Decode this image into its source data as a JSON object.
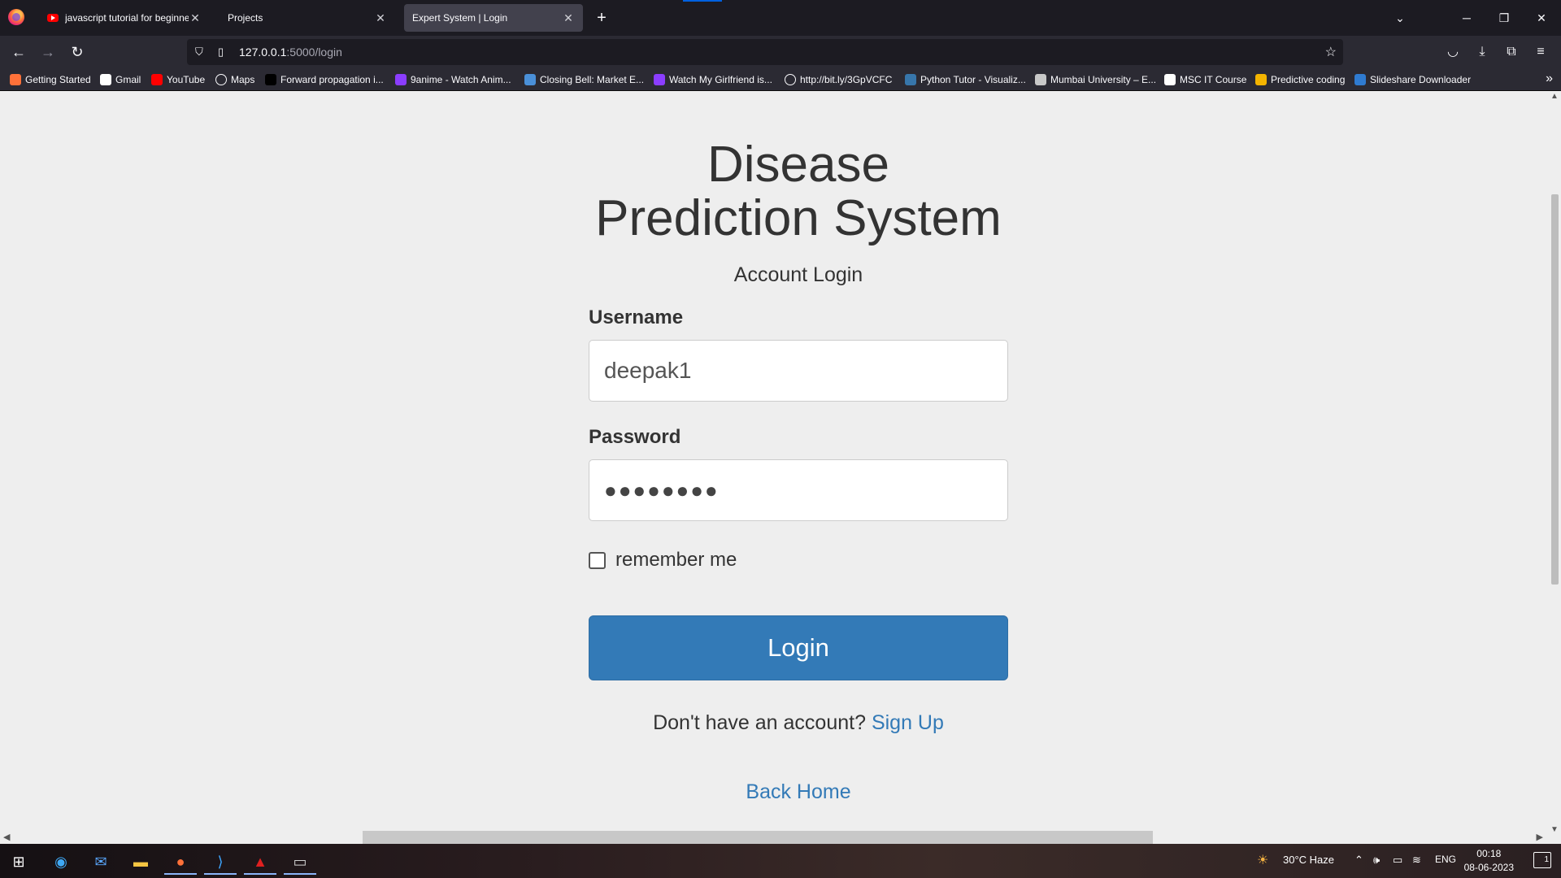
{
  "browser": {
    "tabs": [
      {
        "title": "javascript tutorial for beginners",
        "favicon": "youtube-icon",
        "active": false
      },
      {
        "title": "Projects",
        "favicon": "",
        "active": false
      },
      {
        "title": "Expert System | Login",
        "favicon": "",
        "active": true
      }
    ],
    "url_host": "127.0.0.1",
    "url_path": ":5000/login",
    "bookmarks": [
      {
        "label": "Getting Started",
        "icon": "firefox-icon",
        "color": "#ff7139"
      },
      {
        "label": "Gmail",
        "icon": "google-icon",
        "color": "#ffffff"
      },
      {
        "label": "YouTube",
        "icon": "youtube-icon",
        "color": "#ff0000"
      },
      {
        "label": "Maps",
        "icon": "globe-icon",
        "color": "#2b2a33"
      },
      {
        "label": "Forward propagation i...",
        "icon": "medium-icon",
        "color": "#000000"
      },
      {
        "label": "9anime - Watch Anim...",
        "icon": "play-icon",
        "color": "#8b3dff"
      },
      {
        "label": "Closing Bell: Market E...",
        "icon": "news-icon",
        "color": "#4a90d9"
      },
      {
        "label": "Watch My Girlfriend is...",
        "icon": "play-icon",
        "color": "#8b3dff"
      },
      {
        "label": "http://bit.ly/3GpVCFC",
        "icon": "globe-icon",
        "color": "#2b2a33"
      },
      {
        "label": "Python Tutor - Visualiz...",
        "icon": "python-icon",
        "color": "#3776ab"
      },
      {
        "label": "Mumbai University – E...",
        "icon": "university-icon",
        "color": "#c8c8c8"
      },
      {
        "label": "MSC IT Course",
        "icon": "it-icon",
        "color": "#ffffff"
      },
      {
        "label": "Predictive coding",
        "icon": "doc-icon",
        "color": "#f4b400"
      },
      {
        "label": "Slideshare Downloader",
        "icon": "slideshare-icon",
        "color": "#2f7bd1"
      }
    ]
  },
  "page": {
    "title_line1": "Disease",
    "title_line2": "Prediction System",
    "subtitle": "Account Login",
    "username_label": "Username",
    "username_value": "deepak1",
    "password_label": "Password",
    "password_value": "●●●●●●●●",
    "remember_label": "remember me",
    "login_button": "Login",
    "signup_prompt": "Don't have an account?",
    "signup_link": "Sign Up",
    "back_home": "Back Home",
    "accent_color": "#337ab7"
  },
  "taskbar": {
    "weather": "30°C  Haze",
    "language": "ENG",
    "time": "00:18",
    "date": "08-06-2023",
    "notifications": "1"
  }
}
